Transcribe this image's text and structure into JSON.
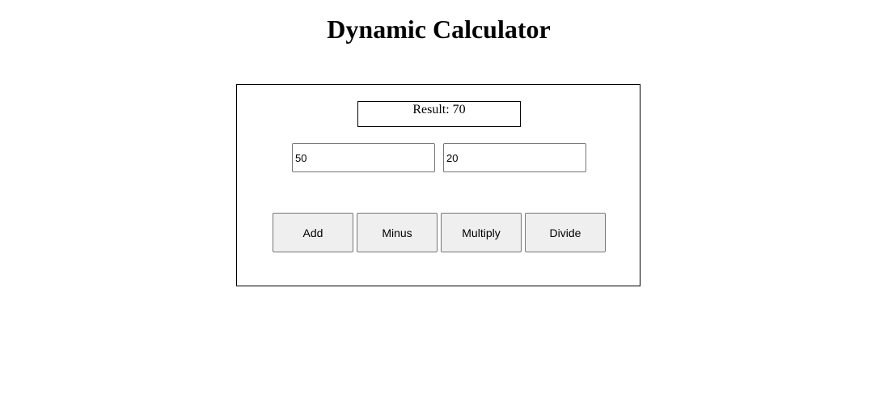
{
  "page": {
    "title": "Dynamic Calculator"
  },
  "calculator": {
    "result_text": "Result: 70",
    "input_a": {
      "value": "50",
      "placeholder": ""
    },
    "input_b": {
      "value": "20",
      "placeholder": ""
    },
    "buttons": {
      "add": "Add",
      "minus": "Minus",
      "multiply": "Multiply",
      "divide": "Divide"
    }
  }
}
